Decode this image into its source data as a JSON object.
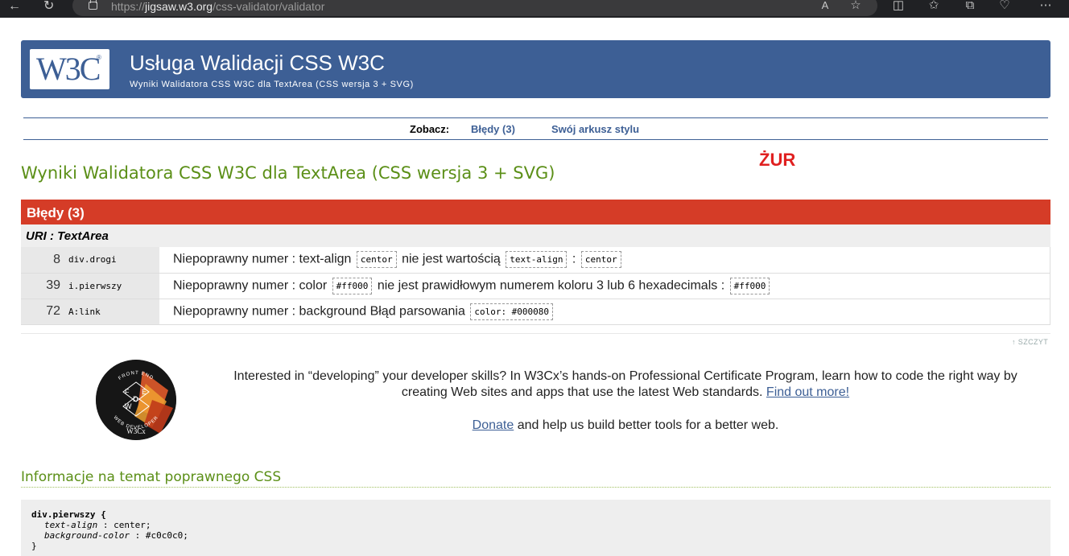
{
  "browser": {
    "url_scheme": "https://",
    "url_host": "jigsaw.w3.org",
    "url_path": "/css-validator/validator"
  },
  "banner": {
    "logo_text": "W3C",
    "logo_reg": "®",
    "title": "Usługa Walidacji CSS W3C",
    "subtitle": "Wyniki Walidatora CSS W3C dla TextArea (CSS wersja 3 + SVG)",
    "bg_color": "#3d5f95"
  },
  "seebar": {
    "label": "Zobacz:",
    "links": [
      "Błędy (3)",
      "Swój arkusz stylu"
    ]
  },
  "annotation": "ŻUR",
  "results_title": "Wyniki Walidatora CSS W3C dla TextArea (CSS wersja 3 + SVG)",
  "errors": {
    "heading": "Błędy (3)",
    "heading_color": "#d53c27",
    "uri": "URI : TextArea",
    "rows": [
      {
        "line": "8",
        "context": "div.drogi",
        "parts": [
          {
            "t": "Niepoprawny numer : text-align "
          },
          {
            "c": "centor"
          },
          {
            "t": " nie jest wartością "
          },
          {
            "c": "text-align"
          },
          {
            "t": " : "
          },
          {
            "c": "centor"
          }
        ]
      },
      {
        "line": "39",
        "context": "i.pierwszy",
        "parts": [
          {
            "t": "Niepoprawny numer : color "
          },
          {
            "c": "#ff000"
          },
          {
            "t": " nie jest prawidłowym numerem koloru 3 lub 6 hexadecimals : "
          },
          {
            "c": "#ff000"
          }
        ]
      },
      {
        "line": "72",
        "context": "A:link",
        "parts": [
          {
            "t": "Niepoprawny numer : background Błąd parsowania "
          },
          {
            "c": "color: #000080"
          }
        ]
      }
    ]
  },
  "top_link": "↑ SZCZYT",
  "promo": {
    "text": "Interested in “developing” your developer skills? In W3Cx’s hands-on Professional Certificate Program, learn how to code the right way by creating Web sites and apps that use the latest Web standards.",
    "link": "Find out more!",
    "donate_link": "Donate",
    "donate_text": " and help us build better tools for a better web.",
    "badge_letters": [
      "F",
      "E",
      "W",
      "D"
    ],
    "badge_ring_top": "FRONT END",
    "badge_ring_bottom": "WEB DEVELOPER",
    "badge_brand": "W3Cx"
  },
  "info_title": "Informacje na temat poprawnego CSS",
  "css_preview": {
    "selector": "div.pierwszy {",
    "lines": [
      {
        "prop": "text-align",
        "value": "center;"
      },
      {
        "prop": "background-color",
        "value": "#c0c0c0;"
      }
    ],
    "close": "}"
  }
}
